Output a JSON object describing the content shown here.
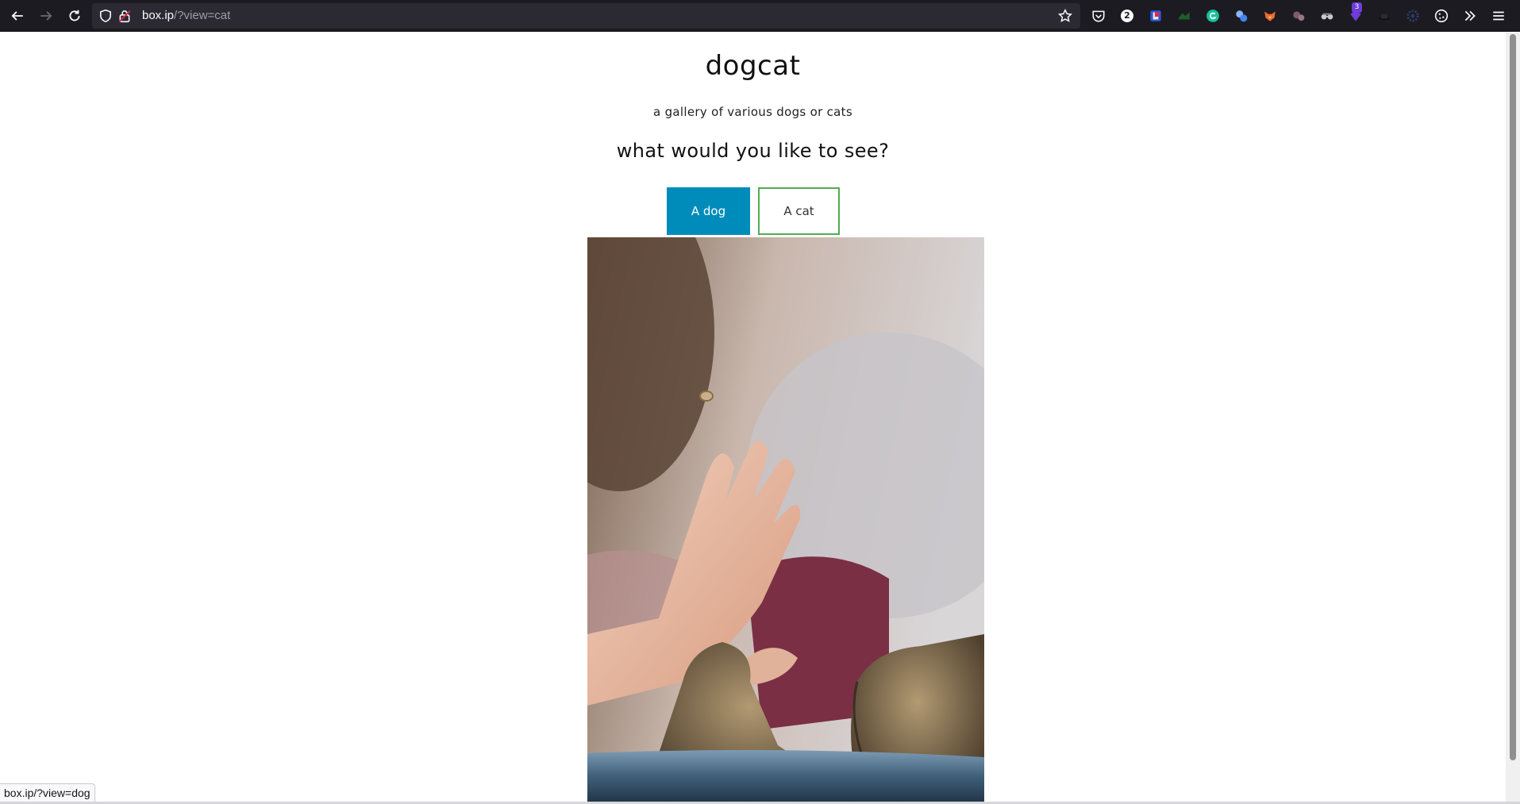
{
  "browser": {
    "url_host": "box.ip",
    "url_path": "/?view=cat",
    "extension_badge": "3",
    "notification_badge": "2",
    "status_url": "box.ip/?view=dog"
  },
  "page": {
    "title": "dogcat",
    "subtitle": "a gallery of various dogs or cats",
    "question": "what would you like to see?",
    "dog_button": "A dog",
    "cat_button": "A cat"
  },
  "colors": {
    "dog_button_bg": "#008cba",
    "cat_button_border": "#4caf50",
    "toolbar_bg": "#1c1b22"
  },
  "icons": [
    "back-icon",
    "forward-icon",
    "reload-icon",
    "shield-icon",
    "lock-icon",
    "bookmark-star-icon",
    "pocket-icon",
    "extensions-icon",
    "menu-icon"
  ]
}
